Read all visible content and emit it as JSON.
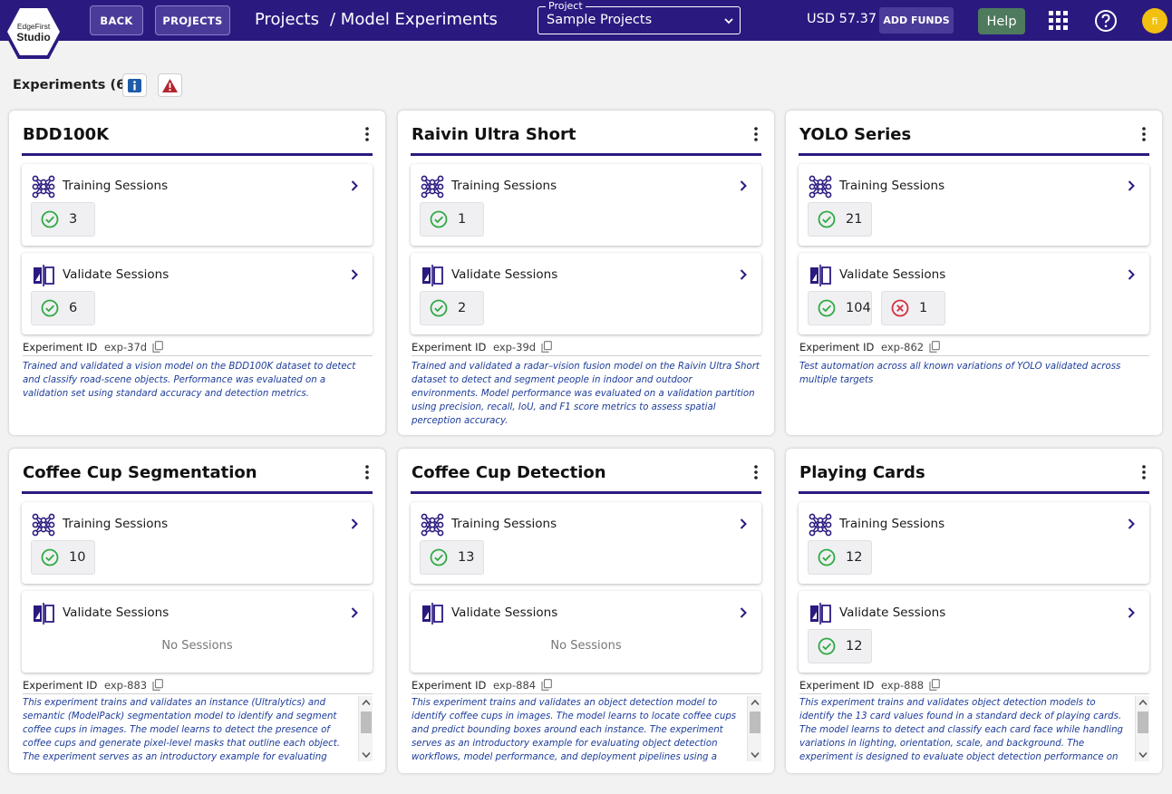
{
  "header": {
    "logo_top": "EdgeFirst",
    "logo_bottom": "Studio",
    "back_label": "BACK",
    "projects_label": "PROJECTS",
    "crumb_projects": "Projects",
    "crumb_current": "/ Model Experiments",
    "project_select_legend": "Project",
    "project_select_value": "Sample Projects",
    "balance": "USD 57.37",
    "add_funds_label": "ADD FUNDS",
    "help_label": "Help",
    "avatar_initial": "fi"
  },
  "experiments_header": "Experiments (6)",
  "labels": {
    "training": "Training Sessions",
    "validate": "Validate Sessions",
    "no_sessions": "No Sessions",
    "experiment_id": "Experiment ID"
  },
  "colors": {
    "brand": "#2a1a80",
    "success": "#2eaa44",
    "error": "#d32f3f",
    "description": "#1c3c9a"
  },
  "icons": [
    "training-sessions-icon",
    "validate-sessions-icon",
    "check-circle-icon",
    "error-circle-icon",
    "chevron-right-icon",
    "kebab-menu-icon",
    "copy-icon",
    "info-icon",
    "warning-icon",
    "apps-grid-icon",
    "help-question-icon"
  ],
  "cards": [
    {
      "title": "BDD100K",
      "training_success": "3",
      "validate_success": "6",
      "validate_failed": null,
      "exp_id": "exp-37d",
      "description": "Trained and validated a vision model on the BDD100K dataset to detect and classify road-scene objects. Performance was evaluated on a validation set using standard accuracy and detection metrics."
    },
    {
      "title": "Raivin Ultra Short",
      "training_success": "1",
      "validate_success": "2",
      "validate_failed": null,
      "exp_id": "exp-39d",
      "description": "Trained and validated a radar–vision fusion model on the Raivin Ultra Short dataset to detect and segment people in indoor and outdoor environments. Model performance was evaluated on a validation partition using precision, recall, IoU, and F1 score metrics to assess spatial perception accuracy."
    },
    {
      "title": "YOLO Series",
      "training_success": "21",
      "validate_success": "104",
      "validate_failed": "1",
      "exp_id": "exp-862",
      "description": "Test automation across all known variations of YOLO validated across multiple targets"
    },
    {
      "title": "Coffee Cup Segmentation",
      "training_success": "10",
      "validate_success": null,
      "validate_failed": null,
      "exp_id": "exp-883",
      "description": "This experiment trains and validates an instance (Ultralytics) and semantic (ModelPack) segmentation model to identify and segment coffee cups in images. The model learns to detect the presence of coffee cups and generate pixel-level masks that outline each object. The experiment serves as an introductory example for evaluating segmentation workflows, model"
    },
    {
      "title": "Coffee Cup Detection",
      "training_success": "13",
      "validate_success": null,
      "validate_failed": null,
      "exp_id": "exp-884",
      "description": "This experiment trains and validates an object detection model to identify coffee cups in images. The model learns to locate coffee cups and predict bounding boxes around each instance. The experiment serves as an introductory example for evaluating object detection workflows, model performance, and deployment pipelines using a simple, single-class dataset."
    },
    {
      "title": "Playing Cards",
      "training_success": "12",
      "validate_success": "12",
      "validate_failed": null,
      "exp_id": "exp-888",
      "description": "This experiment trains and validates object detection models to identify the 13 card values found in a standard deck of playing cards. The model learns to detect and classify each card face while handling variations in lighting, orientation, scale, and background. The experiment is designed to evaluate object detection performance on visually similar classes and serves as a"
    }
  ]
}
